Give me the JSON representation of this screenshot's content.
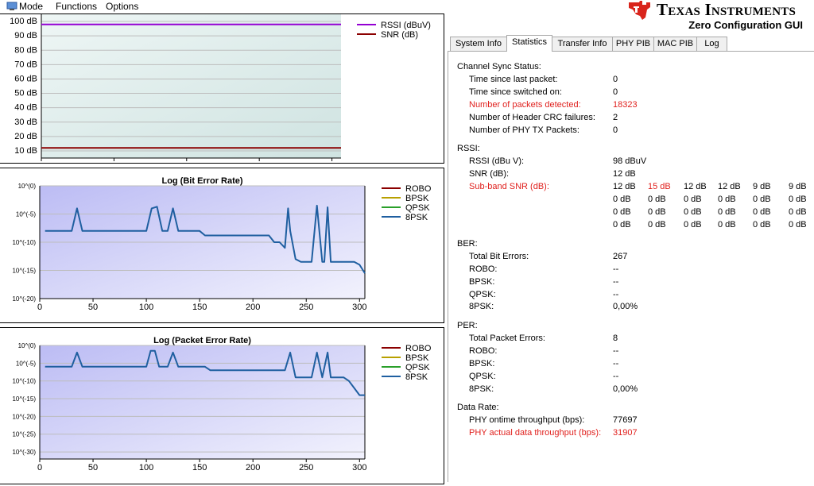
{
  "menu": {
    "mode": "Mode",
    "functions": "Functions",
    "options": "Options"
  },
  "header": {
    "company": "Texas Instruments",
    "app_title": "Zero Configuration GUI"
  },
  "tabs": [
    {
      "label": "System Info",
      "active": false
    },
    {
      "label": "Statistics",
      "active": true
    },
    {
      "label": "Transfer Info",
      "active": false
    },
    {
      "label": "PHY PIB",
      "active": false
    },
    {
      "label": "MAC PIB",
      "active": false
    },
    {
      "label": "Log",
      "active": false
    }
  ],
  "stats": {
    "channel_sync": {
      "heading": "Channel Sync Status:",
      "rows": [
        {
          "label": "Time since last packet:",
          "value": "0",
          "highlight": false
        },
        {
          "label": "Time since switched on:",
          "value": "0",
          "highlight": false
        },
        {
          "label": "Number of packets detected:",
          "value": "18323",
          "highlight": true
        },
        {
          "label": "Number of Header CRC failures:",
          "value": "2",
          "highlight": false
        },
        {
          "label": "Number of PHY TX Packets:",
          "value": "0",
          "highlight": false
        }
      ]
    },
    "rssi": {
      "heading": "RSSI:",
      "rssi_label": "RSSI (dBu V):",
      "rssi_value": "98 dBuV",
      "snr_label": "SNR (dB):",
      "snr_value": "12 dB",
      "subband_label": "Sub-band SNR (dB):",
      "subband": [
        [
          {
            "v": "12 dB",
            "hl": false
          },
          {
            "v": "15 dB",
            "hl": true
          },
          {
            "v": "12 dB",
            "hl": false
          },
          {
            "v": "12 dB",
            "hl": false
          },
          {
            "v": "9 dB",
            "hl": false
          },
          {
            "v": "9 dB",
            "hl": false
          }
        ],
        [
          {
            "v": "0 dB",
            "hl": false
          },
          {
            "v": "0 dB",
            "hl": false
          },
          {
            "v": "0 dB",
            "hl": false
          },
          {
            "v": "0 dB",
            "hl": false
          },
          {
            "v": "0 dB",
            "hl": false
          },
          {
            "v": "0 dB",
            "hl": false
          }
        ],
        [
          {
            "v": "0 dB",
            "hl": false
          },
          {
            "v": "0 dB",
            "hl": false
          },
          {
            "v": "0 dB",
            "hl": false
          },
          {
            "v": "0 dB",
            "hl": false
          },
          {
            "v": "0 dB",
            "hl": false
          },
          {
            "v": "0 dB",
            "hl": false
          }
        ],
        [
          {
            "v": "0 dB",
            "hl": false
          },
          {
            "v": "0 dB",
            "hl": false
          },
          {
            "v": "0 dB",
            "hl": false
          },
          {
            "v": "0 dB",
            "hl": false
          },
          {
            "v": "0 dB",
            "hl": false
          },
          {
            "v": "0 dB",
            "hl": false
          }
        ]
      ]
    },
    "ber": {
      "heading": "BER:",
      "rows": [
        {
          "label": "Total Bit Errors:",
          "value": "267"
        },
        {
          "label": "ROBO:",
          "value": "--"
        },
        {
          "label": "BPSK:",
          "value": "--"
        },
        {
          "label": "QPSK:",
          "value": "--"
        },
        {
          "label": "8PSK:",
          "value": "0,00%"
        }
      ]
    },
    "per": {
      "heading": "PER:",
      "rows": [
        {
          "label": "Total Packet Errors:",
          "value": "8"
        },
        {
          "label": "ROBO:",
          "value": "--"
        },
        {
          "label": "BPSK:",
          "value": "--"
        },
        {
          "label": "QPSK:",
          "value": "--"
        },
        {
          "label": "8PSK:",
          "value": "0,00%"
        }
      ]
    },
    "data_rate": {
      "heading": "Data Rate:",
      "rows": [
        {
          "label": "PHY ontime throughput (bps):",
          "value": "77697",
          "highlight": false
        },
        {
          "label": "PHY actual data throughput (bps):",
          "value": "31907",
          "highlight": true
        }
      ]
    }
  },
  "colors": {
    "rssi": "#9400d3",
    "snr": "#8b0000",
    "robo": "#8b0000",
    "bpsk": "#b8a000",
    "qpsk": "#2aa02a",
    "8psk": "#1f5fa0",
    "highlight": "#e0201d"
  },
  "chart_data": [
    {
      "type": "line",
      "title": "",
      "xlim": [
        0,
        330
      ],
      "ylim": [
        5,
        105
      ],
      "xticks": [
        "0",
        "80",
        "160",
        "240",
        "320"
      ],
      "yticks": [
        "10 dB",
        "20 dB",
        "30 dB",
        "40 dB",
        "50 dB",
        "60 dB",
        "70 dB",
        "80 dB",
        "90 dB",
        "100 dB"
      ],
      "series": [
        {
          "name": "RSSI (dBuV)",
          "x": [
            0,
            330
          ],
          "y": [
            98,
            98
          ]
        },
        {
          "name": "SNR (dB)",
          "x": [
            0,
            330
          ],
          "y": [
            12,
            12
          ]
        }
      ]
    },
    {
      "type": "line",
      "title": "Log (Bit Error Rate)",
      "xlim": [
        0,
        305
      ],
      "ylim": [
        -20,
        0
      ],
      "xticks": [
        "0",
        "50",
        "100",
        "150",
        "200",
        "250",
        "300"
      ],
      "yticks": [
        "10^(0)",
        "10^(-5)",
        "10^(-10)",
        "10^(-15)",
        "10^(-20)"
      ],
      "series": [
        {
          "name": "ROBO",
          "x": [],
          "y": []
        },
        {
          "name": "BPSK",
          "x": [],
          "y": []
        },
        {
          "name": "QPSK",
          "x": [],
          "y": []
        },
        {
          "name": "8PSK",
          "x": [
            5,
            30,
            35,
            40,
            100,
            105,
            110,
            115,
            120,
            125,
            130,
            135,
            150,
            155,
            160,
            200,
            205,
            210,
            215,
            220,
            225,
            230,
            233,
            235,
            240,
            245,
            250,
            255,
            260,
            265,
            267,
            270,
            273,
            275,
            280,
            285,
            290,
            295,
            300,
            305
          ],
          "y": [
            -8,
            -8,
            -4,
            -8,
            -8,
            -4,
            -3.7,
            -8,
            -8,
            -4,
            -8,
            -8,
            -8,
            -8.8,
            -8.8,
            -8.8,
            -8.8,
            -8.8,
            -8.8,
            -10,
            -10,
            -11,
            -4,
            -8,
            -13,
            -13.5,
            -13.5,
            -13.5,
            -3.5,
            -13.5,
            -13.5,
            -3.8,
            -13.5,
            -13.5,
            -13.5,
            -13.5,
            -13.5,
            -13.5,
            -14,
            -15.5
          ]
        }
      ]
    },
    {
      "type": "line",
      "title": "Log (Packet Error Rate)",
      "xlim": [
        0,
        305
      ],
      "ylim": [
        -32,
        0
      ],
      "xticks": [
        "0",
        "50",
        "100",
        "150",
        "200",
        "250",
        "300"
      ],
      "yticks": [
        "10^(0)",
        "10^(-5)",
        "10^(-10)",
        "10^(-15)",
        "10^(-20)",
        "10^(-25)",
        "10^(-30)"
      ],
      "series": [
        {
          "name": "ROBO",
          "x": [],
          "y": []
        },
        {
          "name": "BPSK",
          "x": [],
          "y": []
        },
        {
          "name": "QPSK",
          "x": [],
          "y": []
        },
        {
          "name": "8PSK",
          "x": [
            5,
            30,
            35,
            40,
            100,
            104,
            108,
            112,
            120,
            125,
            130,
            155,
            160,
            230,
            235,
            240,
            245,
            250,
            255,
            260,
            265,
            270,
            273,
            275,
            280,
            285,
            290,
            295,
            300,
            305
          ],
          "y": [
            -6,
            -6,
            -2,
            -6,
            -6,
            -1.5,
            -1.5,
            -6,
            -6,
            -2,
            -6,
            -6,
            -7,
            -7,
            -2,
            -9,
            -9,
            -9,
            -9,
            -2,
            -9,
            -2,
            -9,
            -9,
            -9,
            -9,
            -10,
            -12,
            -14,
            -14
          ]
        }
      ]
    }
  ]
}
